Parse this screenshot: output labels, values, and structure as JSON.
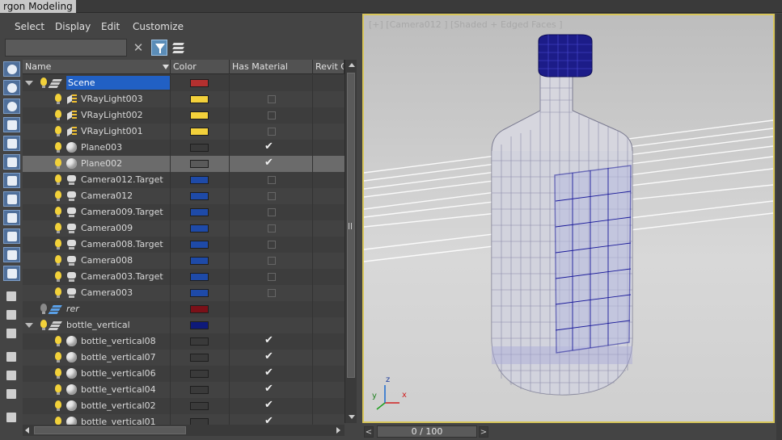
{
  "window": {
    "title": "rgon Modeling"
  },
  "menu": [
    {
      "label": "Select"
    },
    {
      "label": "Display"
    },
    {
      "label": "Edit"
    },
    {
      "label": "Customize"
    }
  ],
  "search": {
    "value": "",
    "placeholder": ""
  },
  "columns": [
    "Name",
    "Color",
    "Has Material",
    "Revit C"
  ],
  "rows": [
    {
      "name": "Scene",
      "icon": "layer-icon",
      "color": "#b4302f",
      "material": "none",
      "bulb": "on",
      "expander": true,
      "indent": 0,
      "selected": true
    },
    {
      "name": "VRayLight003",
      "icon": "light-icon",
      "color": "#f3d13b",
      "material": "unchecked",
      "bulb": "on",
      "indent": 1
    },
    {
      "name": "VRayLight002",
      "icon": "light-icon",
      "color": "#f3d13b",
      "material": "unchecked",
      "bulb": "on",
      "indent": 1
    },
    {
      "name": "VRayLight001",
      "icon": "light-icon",
      "color": "#f3d13b",
      "material": "unchecked",
      "bulb": "on",
      "indent": 1
    },
    {
      "name": "Plane003",
      "icon": "sphere-icon",
      "color": "#3a3a3a",
      "material": "checked",
      "bulb": "on",
      "indent": 1
    },
    {
      "name": "Plane002",
      "icon": "sphere-icon",
      "color": "#5a5a5a",
      "material": "checked",
      "bulb": "on",
      "indent": 1,
      "highlight": true
    },
    {
      "name": "Camera012.Target",
      "icon": "camera-icon",
      "color": "#1e4aa8",
      "material": "unchecked",
      "bulb": "on",
      "indent": 1
    },
    {
      "name": "Camera012",
      "icon": "camera-icon",
      "color": "#1e4aa8",
      "material": "unchecked",
      "bulb": "on",
      "indent": 1
    },
    {
      "name": "Camera009.Target",
      "icon": "camera-icon",
      "color": "#1e4aa8",
      "material": "unchecked",
      "bulb": "on",
      "indent": 1
    },
    {
      "name": "Camera009",
      "icon": "camera-icon",
      "color": "#1e4aa8",
      "material": "unchecked",
      "bulb": "on",
      "indent": 1
    },
    {
      "name": "Camera008.Target",
      "icon": "camera-icon",
      "color": "#1e4aa8",
      "material": "unchecked",
      "bulb": "on",
      "indent": 1
    },
    {
      "name": "Camera008",
      "icon": "camera-icon",
      "color": "#1e4aa8",
      "material": "unchecked",
      "bulb": "on",
      "indent": 1
    },
    {
      "name": "Camera003.Target",
      "icon": "camera-icon",
      "color": "#1e4aa8",
      "material": "unchecked",
      "bulb": "on",
      "indent": 1
    },
    {
      "name": "Camera003",
      "icon": "camera-icon",
      "color": "#1e4aa8",
      "material": "unchecked",
      "bulb": "on",
      "indent": 1
    },
    {
      "name": "rer",
      "icon": "layer-blue-icon",
      "color": "#7a1018",
      "material": "none",
      "bulb": "off",
      "indent": 0,
      "italic": true
    },
    {
      "name": "bottle_vertical",
      "icon": "layer-icon",
      "color": "#0e1a7a",
      "material": "none",
      "bulb": "on",
      "expander": true,
      "indent": 0
    },
    {
      "name": "bottle_vertical08",
      "icon": "sphere-icon",
      "color": "#3a3a3a",
      "material": "checked",
      "bulb": "on",
      "indent": 1
    },
    {
      "name": "bottle_vertical07",
      "icon": "sphere-icon",
      "color": "#3a3a3a",
      "material": "checked",
      "bulb": "on",
      "indent": 1
    },
    {
      "name": "bottle_vertical06",
      "icon": "sphere-icon",
      "color": "#3a3a3a",
      "material": "checked",
      "bulb": "on",
      "indent": 1
    },
    {
      "name": "bottle_vertical04",
      "icon": "sphere-icon",
      "color": "#3a3a3a",
      "material": "checked",
      "bulb": "on",
      "indent": 1
    },
    {
      "name": "bottle_vertical02",
      "icon": "sphere-icon",
      "color": "#3a3a3a",
      "material": "checked",
      "bulb": "on",
      "indent": 1
    },
    {
      "name": "bottle_vertical01",
      "icon": "sphere-icon",
      "color": "#3a3a3a",
      "material": "checked",
      "bulb": "on",
      "indent": 1
    }
  ],
  "viewport": {
    "label": "[+] [Camera012 ] [Shaded + Edged Faces ]"
  },
  "axes": {
    "x": "x",
    "y": "y",
    "z": "z"
  },
  "timeline": {
    "position": "0 / 100",
    "prev": "<",
    "next": ">"
  }
}
